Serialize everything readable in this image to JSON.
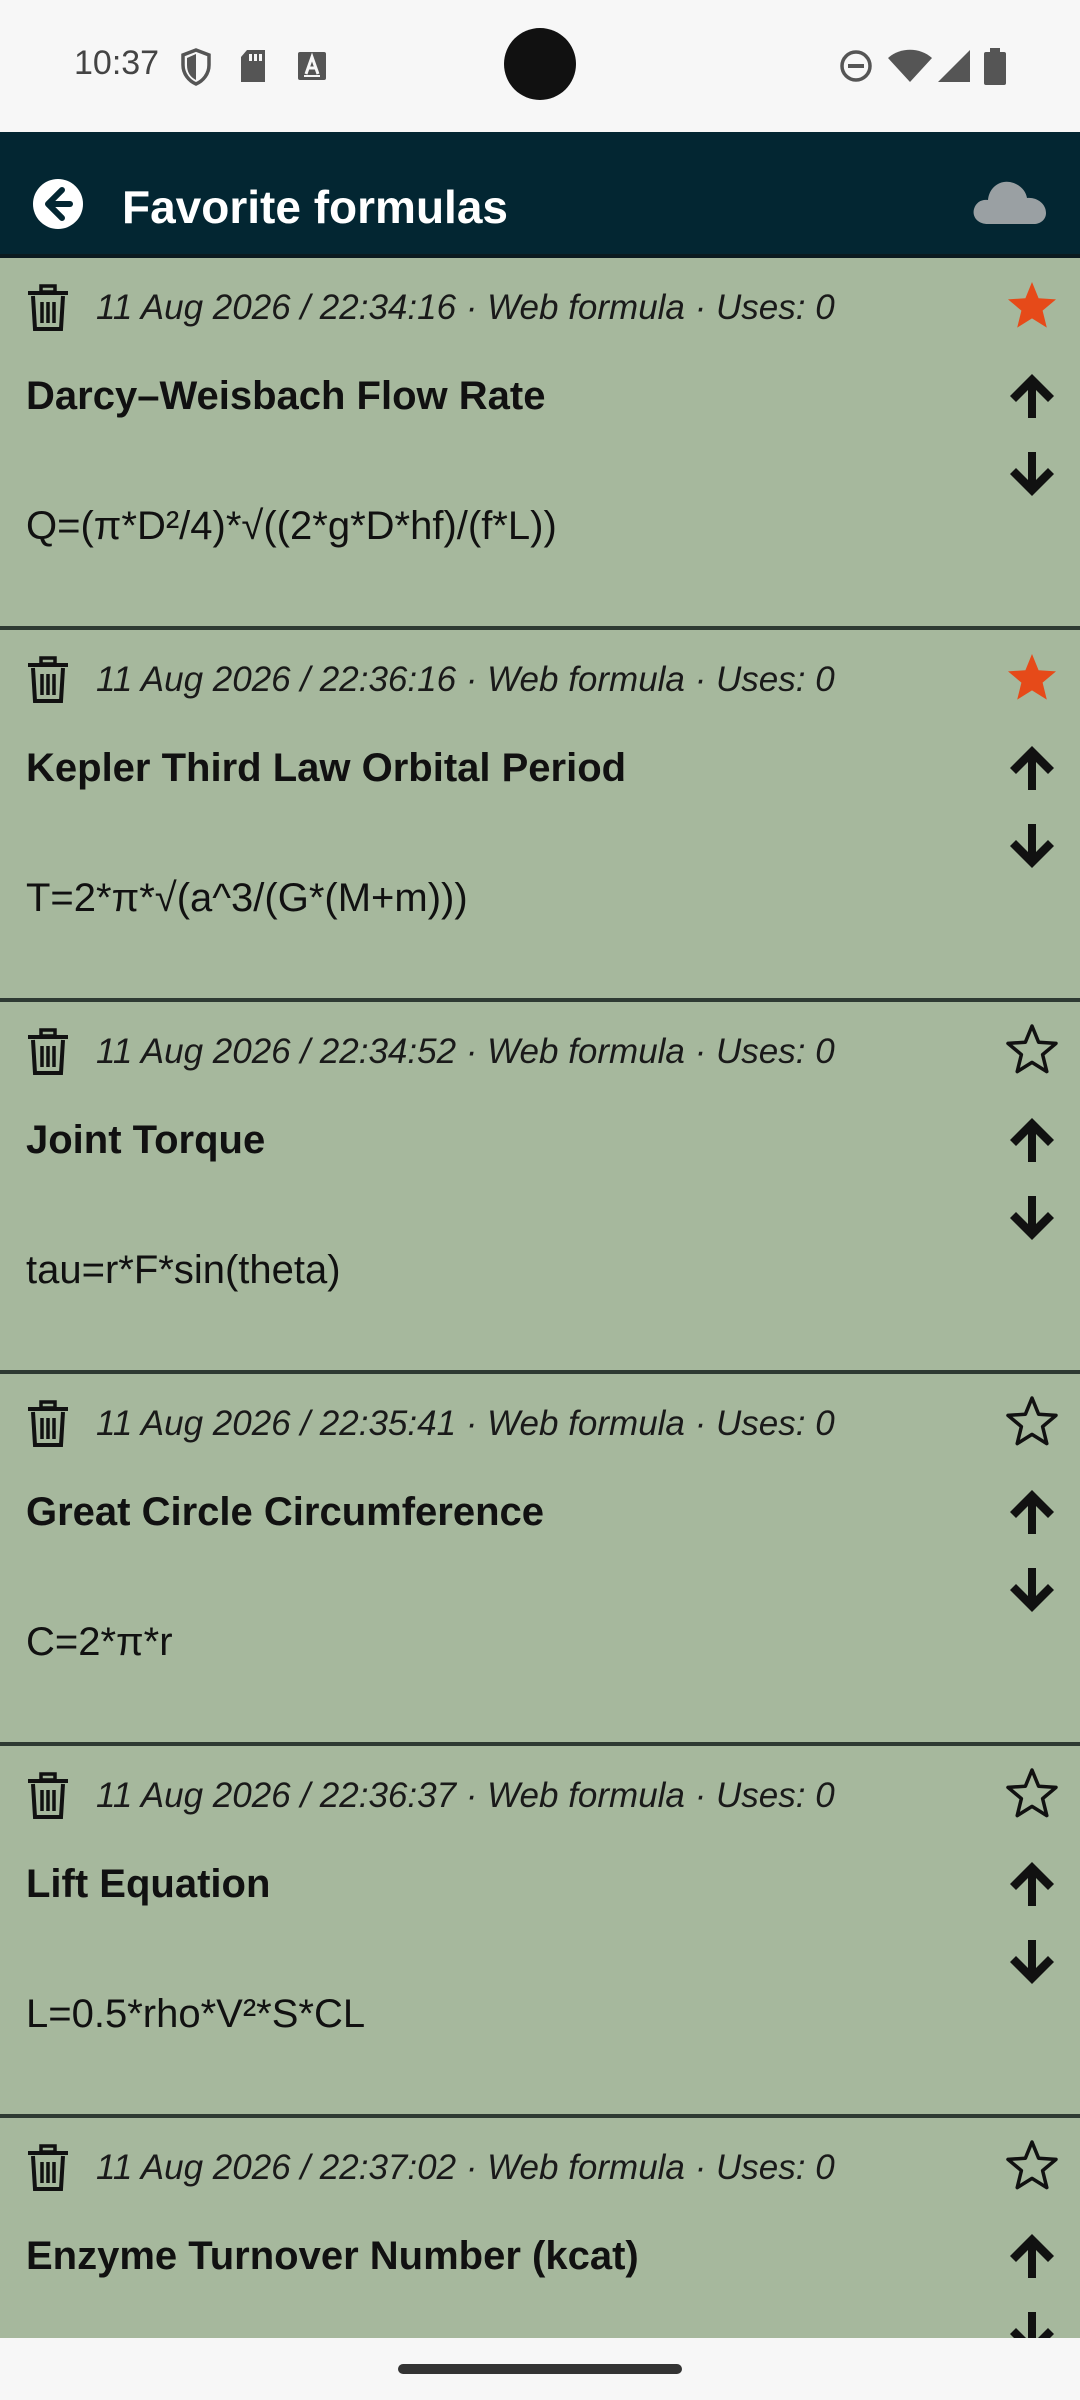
{
  "status_bar": {
    "time": "10:37",
    "left_icons": [
      "shield-icon",
      "sd-card-icon",
      "a-box-icon"
    ],
    "right_icons": [
      "do-not-disturb-icon",
      "wifi-icon",
      "cell-signal-icon",
      "battery-icon"
    ]
  },
  "app_bar": {
    "title": "Favorite formulas",
    "back_icon": "back-arrow-icon",
    "action_icon": "cloud-icon",
    "background": "#032632"
  },
  "colors": {
    "card_bg": "#a6b89d",
    "star_active": "#e64a19",
    "divider": "#2e3a33"
  },
  "formulas": [
    {
      "meta": "11 Aug 2026 / 22:34:16 · Web formula · Uses: 0",
      "title": "Darcy–Weisbach Flow Rate",
      "formula": "Q=(π*D²/4)*√((2*g*D*hf)/(f*L))",
      "favorite": true
    },
    {
      "meta": "11 Aug 2026 / 22:36:16 · Web formula · Uses: 0",
      "title": "Kepler Third Law Orbital Period",
      "formula": "T=2*π*√(a^3/(G*(M+m)))",
      "favorite": true
    },
    {
      "meta": "11 Aug 2026 / 22:34:52 · Web formula · Uses: 0",
      "title": "Joint Torque",
      "formula": "tau=r*F*sin(theta)",
      "favorite": false
    },
    {
      "meta": "11 Aug 2026 / 22:35:41 · Web formula · Uses: 0",
      "title": "Great Circle Circumference",
      "formula": "C=2*π*r",
      "favorite": false
    },
    {
      "meta": "11 Aug 2026 / 22:36:37 · Web formula · Uses: 0",
      "title": "Lift Equation",
      "formula": "L=0.5*rho*V²*S*CL",
      "favorite": false
    },
    {
      "meta": "11 Aug 2026 / 22:37:02 · Web formula · Uses: 0",
      "title": "Enzyme Turnover Number (kcat)",
      "formula": "",
      "favorite": false
    }
  ]
}
